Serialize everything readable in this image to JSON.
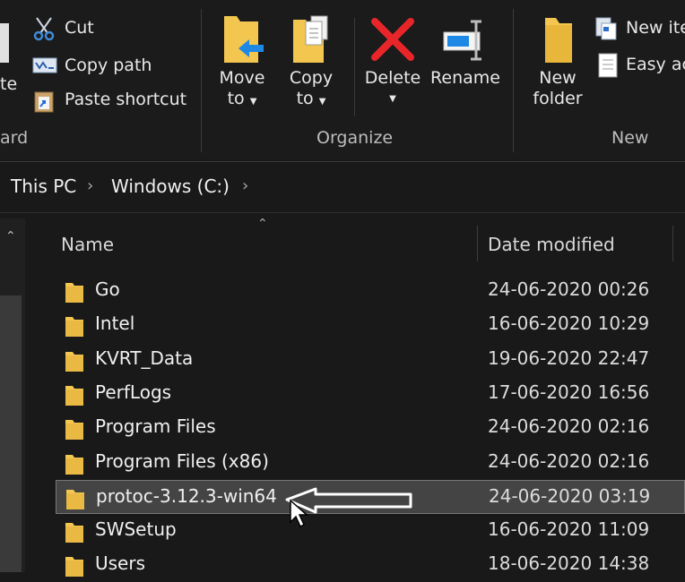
{
  "ribbon": {
    "clipboard": {
      "cut": "Cut",
      "copy_path": "Copy path",
      "paste_shortcut": "Paste shortcut",
      "paste_partial": "te",
      "group_partial": "ard"
    },
    "organize": {
      "move_to_line1": "Move",
      "move_to_line2": "to",
      "copy_to_line1": "Copy",
      "copy_to_line2": "to",
      "delete": "Delete",
      "rename": "Rename",
      "group": "Organize"
    },
    "new": {
      "new_folder_line1": "New",
      "new_folder_line2": "folder",
      "new_item": "New ite",
      "easy_access": "Easy ac",
      "group": "New"
    }
  },
  "address": {
    "crumbs": [
      "This PC",
      "Windows (C:)"
    ]
  },
  "columns": {
    "name": "Name",
    "date": "Date modified"
  },
  "files": [
    {
      "name": "Go",
      "date": "24-06-2020 00:26"
    },
    {
      "name": "Intel",
      "date": "16-06-2020 10:29"
    },
    {
      "name": "KVRT_Data",
      "date": "19-06-2020 22:47"
    },
    {
      "name": "PerfLogs",
      "date": "17-06-2020 16:56"
    },
    {
      "name": "Program Files",
      "date": "24-06-2020 02:16"
    },
    {
      "name": "Program Files (x86)",
      "date": "24-06-2020 02:16"
    },
    {
      "name": "protoc-3.12.3-win64",
      "date": "24-06-2020 03:19",
      "selected": true
    },
    {
      "name": "SWSetup",
      "date": "16-06-2020 11:09"
    },
    {
      "name": "Users",
      "date": "18-06-2020 14:38"
    }
  ],
  "colors": {
    "background": "#191919",
    "folder": "#f3c74f",
    "selected_row": "#444444",
    "delete_red": "#e8262a",
    "move_arrow_blue": "#1e88e5"
  }
}
